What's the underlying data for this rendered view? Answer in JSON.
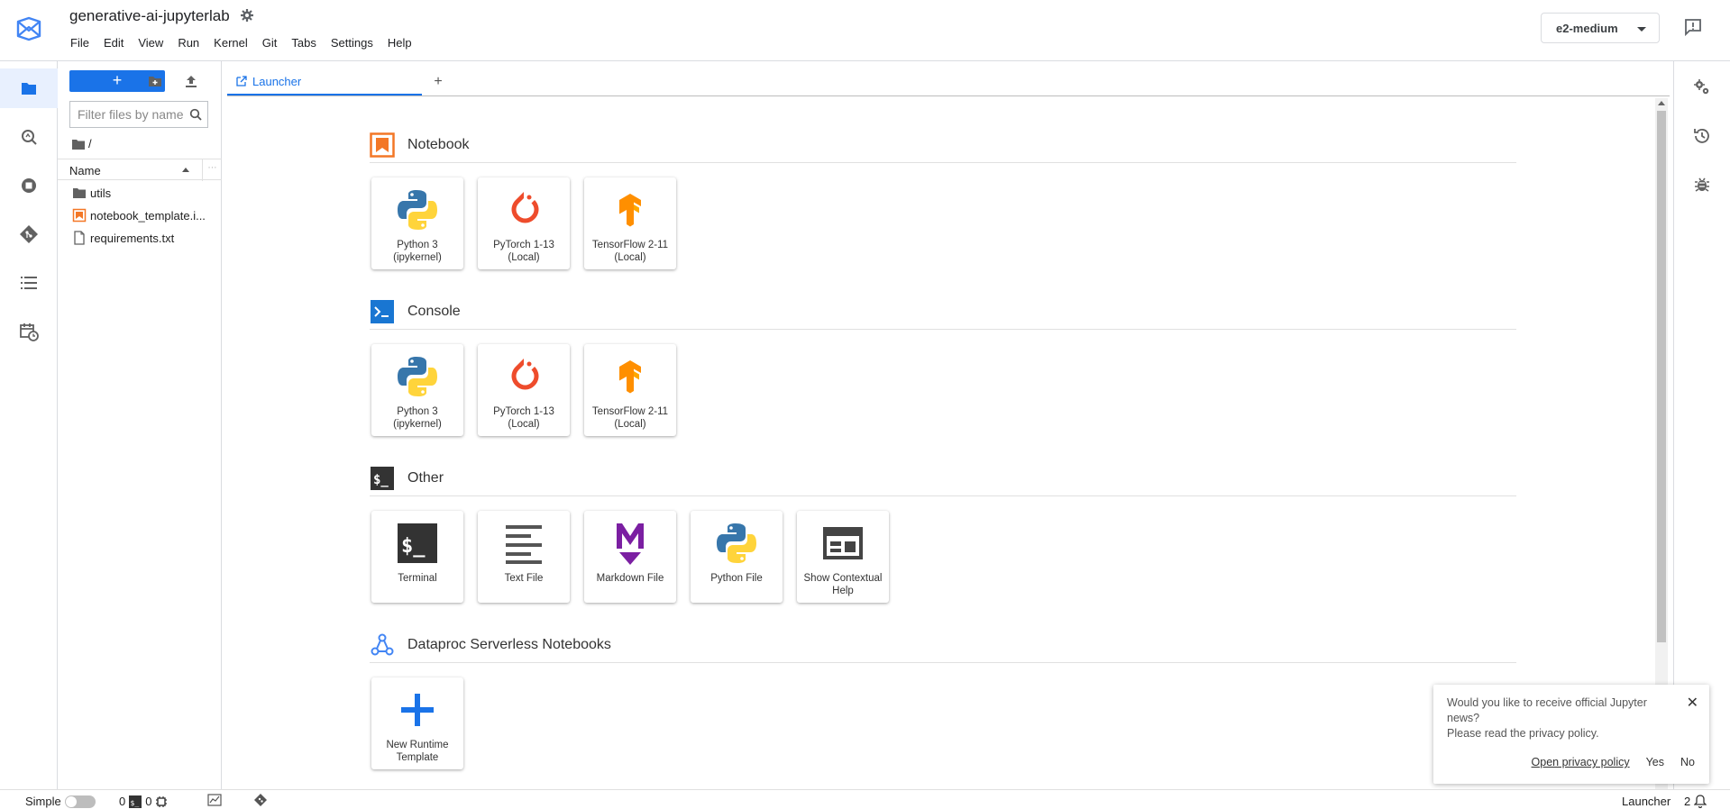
{
  "header": {
    "title": "generative-ai-jupyterlab",
    "menu": [
      "File",
      "Edit",
      "View",
      "Run",
      "Kernel",
      "Git",
      "Tabs",
      "Settings",
      "Help"
    ],
    "machine_type": "e2-medium"
  },
  "filebrowser": {
    "new_label": "+",
    "filter_placeholder": "Filter files by name",
    "breadcrumb": "/",
    "column_name": "Name",
    "files": [
      {
        "name": "utils",
        "type": "folder"
      },
      {
        "name": "notebook_template.i...",
        "type": "notebook"
      },
      {
        "name": "requirements.txt",
        "type": "file"
      }
    ]
  },
  "tabs": {
    "active": "Launcher",
    "add": "+"
  },
  "launcher": {
    "sections": [
      {
        "title": "Notebook",
        "icon": "notebook-icon",
        "items": [
          {
            "label": "Python 3 (ipykernel)",
            "icon": "python-icon"
          },
          {
            "label": "PyTorch 1-13 (Local)",
            "icon": "pytorch-icon"
          },
          {
            "label": "TensorFlow 2-11 (Local)",
            "icon": "tensorflow-icon"
          }
        ]
      },
      {
        "title": "Console",
        "icon": "console-icon",
        "items": [
          {
            "label": "Python 3 (ipykernel)",
            "icon": "python-icon"
          },
          {
            "label": "PyTorch 1-13 (Local)",
            "icon": "pytorch-icon"
          },
          {
            "label": "TensorFlow 2-11 (Local)",
            "icon": "tensorflow-icon"
          }
        ]
      },
      {
        "title": "Other",
        "icon": "terminal-icon",
        "items": [
          {
            "label": "Terminal",
            "icon": "terminal-icon"
          },
          {
            "label": "Text File",
            "icon": "text-file-icon"
          },
          {
            "label": "Markdown File",
            "icon": "markdown-icon"
          },
          {
            "label": "Python File",
            "icon": "python-icon"
          },
          {
            "label": "Show Contextual Help",
            "icon": "contextual-help-icon"
          }
        ]
      },
      {
        "title": "Dataproc Serverless Notebooks",
        "icon": "dataproc-icon",
        "items": [
          {
            "label": "New Runtime Template",
            "icon": "plus-icon"
          }
        ]
      }
    ]
  },
  "notification": {
    "line1": "Would you like to receive official Jupyter news?",
    "line2": "Please read the privacy policy.",
    "open_policy": "Open privacy policy",
    "yes": "Yes",
    "no": "No",
    "close": "✕"
  },
  "statusbar": {
    "mode_label": "Simple",
    "terminals": "0",
    "kernels": "0",
    "active_tab": "Launcher",
    "notifications": "2"
  },
  "colors": {
    "accent": "#1a73e8",
    "notebook_orange": "#f37726",
    "console_blue": "#1976d2",
    "tensorflow_orange": "#ff8f00",
    "pytorch_red": "#ee4c2c",
    "markdown_purple": "#7b1fa2"
  }
}
